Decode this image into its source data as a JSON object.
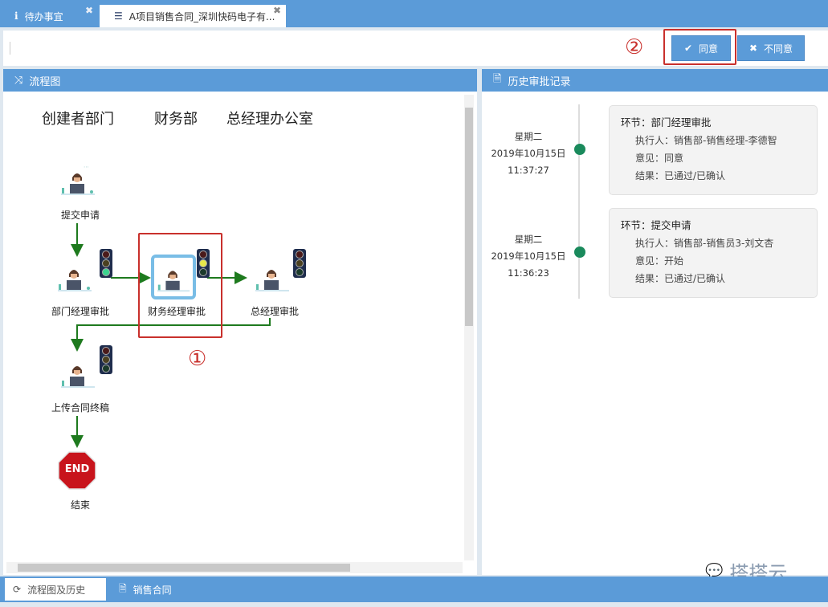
{
  "tabs": [
    {
      "label": "待办事宜",
      "icon": "info-icon",
      "closable": true
    },
    {
      "label": "A项目销售合同_深圳快码电子有...",
      "icon": "list-icon",
      "closable": true,
      "active": true
    }
  ],
  "toolbar": {
    "agree_label": "同意",
    "disagree_label": "不同意",
    "annotation_2": "②"
  },
  "flow_panel": {
    "title": "流程图",
    "lanes": [
      "创建者部门",
      "财务部",
      "总经理办公室"
    ],
    "nodes": [
      {
        "label": "提交申请"
      },
      {
        "label": "部门经理审批",
        "light": "green"
      },
      {
        "label": "财务经理审批",
        "light": "yellow",
        "current": true
      },
      {
        "label": "总经理审批",
        "light": "off"
      },
      {
        "label": "上传合同终稿",
        "light": "off"
      },
      {
        "label": "结束",
        "badge": "END"
      }
    ],
    "annotation_1": "①"
  },
  "history_panel": {
    "title": "历史审批记录",
    "records": [
      {
        "weekday": "星期二",
        "date": "2019年10月15日",
        "time": "11:37:27",
        "step": "环节：部门经理审批",
        "executor": "执行人：销售部-销售经理-李德智",
        "opinion": "意见：同意",
        "result": "结果：已通过/已确认"
      },
      {
        "weekday": "星期二",
        "date": "2019年10月15日",
        "time": "11:36:23",
        "step": "环节：提交申请",
        "executor": "执行人：销售部-销售员3-刘文杏",
        "opinion": "意见：开始",
        "result": "结果：已通过/已确认"
      }
    ]
  },
  "bottom_tabs": [
    {
      "label": "流程图及历史",
      "active": true
    },
    {
      "label": "销售合同"
    }
  ],
  "watermark": "搭搭云",
  "colors": {
    "accent": "#5b9bd8",
    "annotation": "#c9302c",
    "timeline_dot": "#1a8a5c",
    "arrow": "#1e7a1e"
  }
}
